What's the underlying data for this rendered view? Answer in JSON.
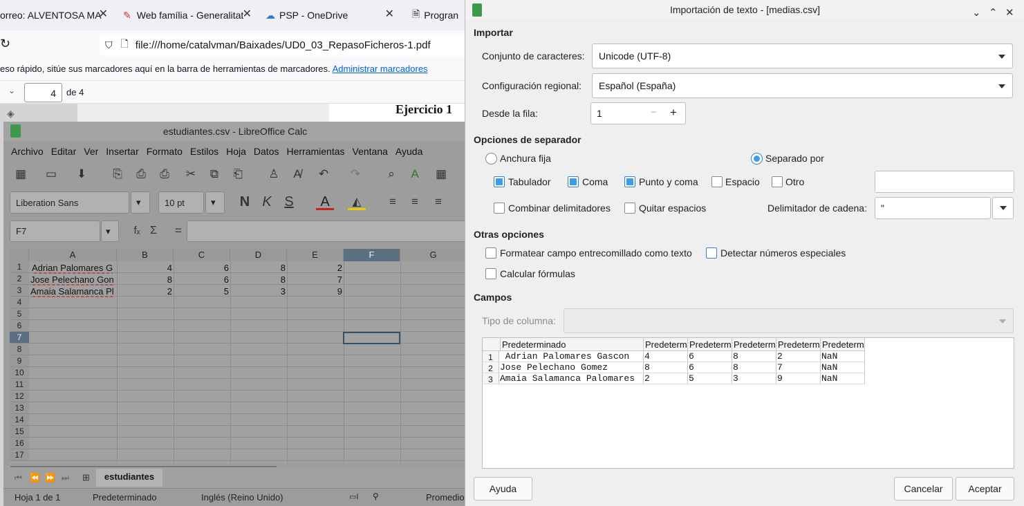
{
  "browser": {
    "tabs": [
      {
        "label": "orreo: ALVENTOSA MA"
      },
      {
        "label": "Web família - Generalitat"
      },
      {
        "label": "PSP - OneDrive"
      },
      {
        "label": "Progran"
      }
    ],
    "url": "file:///home/catalvman/Baixades/UD0_03_RepasoFicheros-1.pdf",
    "bookmarks_text": "eso rápido, sitúe sus marcadores aquí en la barra de herramientas de marcadores.",
    "bookmarks_link": "Administrar marcadores",
    "page_number": "4",
    "page_total": "de 4",
    "pdf_heading": "Ejercicio 1"
  },
  "calc": {
    "title": "estudiantes.csv - LibreOffice Calc",
    "menu": [
      "Archivo",
      "Editar",
      "Ver",
      "Insertar",
      "Formato",
      "Estilos",
      "Hoja",
      "Datos",
      "Herramientas",
      "Ventana",
      "Ayuda"
    ],
    "font_name": "Liberation Sans",
    "font_size": "10 pt",
    "name_box": "F7",
    "formula_icons": {
      "fx": "fₓ",
      "sigma": "Σ",
      "equals": "="
    },
    "columns": [
      "A",
      "B",
      "C",
      "D",
      "E",
      "F",
      "G"
    ],
    "rows": [
      "1",
      "2",
      "3",
      "4",
      "5",
      "6",
      "7",
      "8",
      "9",
      "10",
      "11",
      "12",
      "13",
      "14",
      "15",
      "16",
      "17"
    ],
    "data": [
      [
        "Adrian Palomares G",
        "4",
        "6",
        "8",
        "2"
      ],
      [
        "Jose Pelechano Gon",
        "8",
        "6",
        "8",
        "7"
      ],
      [
        "Amaia Salamanca Pl",
        "2",
        "5",
        "3",
        "9"
      ]
    ],
    "sheet_tab": "estudiantes",
    "status": {
      "sheet": "Hoja 1 de 1",
      "style": "Predeterminado",
      "lang": "Inglés (Reino Unido)",
      "avg": "Promedio"
    }
  },
  "dialog": {
    "title": "Importación de texto - [medias.csv]",
    "import_section": "Importar",
    "charset_label": "Conjunto de caracteres:",
    "charset_value": "Unicode (UTF-8)",
    "locale_label": "Configuración regional:",
    "locale_value": "Español (España)",
    "from_row_label": "Desde la fila:",
    "from_row_value": "1",
    "separator_section": "Opciones de separador",
    "fixed_width": "Anchura fija",
    "separated_by": "Separado por",
    "tab_label": "Tabulador",
    "comma_label": "Coma",
    "semicolon_label": "Punto y coma",
    "space_label": "Espacio",
    "other_label": "Otro",
    "merge_label": "Combinar delimitadores",
    "trim_label": "Quitar espacios",
    "string_delim_label": "Delimitador de cadena:",
    "string_delim_value": "\"",
    "other_section": "Otras opciones",
    "quoted_label": "Formatear campo entrecomillado como texto",
    "special_numbers_label": "Detectar números especiales",
    "formulas_label": "Calcular fórmulas",
    "fields_section": "Campos",
    "column_type_label": "Tipo de columna:",
    "preview_headers": [
      "Predeterminado",
      "Predeterm",
      "Predeterm",
      "Predeterm",
      "Predeterm",
      "Predeterm"
    ],
    "preview_rows": [
      {
        "n": "1",
        "cells": [
          " Adrian Palomares Gascon",
          "4",
          "6",
          "8",
          "2",
          "NaN"
        ]
      },
      {
        "n": "2",
        "cells": [
          "Jose Pelechano Gomez",
          "8",
          "6",
          "8",
          "7",
          "NaN"
        ]
      },
      {
        "n": "3",
        "cells": [
          "Amaia Salamanca Palomares",
          "2",
          "5",
          "3",
          "9",
          "NaN"
        ]
      }
    ],
    "help_button": "Ayuda",
    "cancel_button": "Cancelar",
    "ok_button": "Aceptar"
  }
}
